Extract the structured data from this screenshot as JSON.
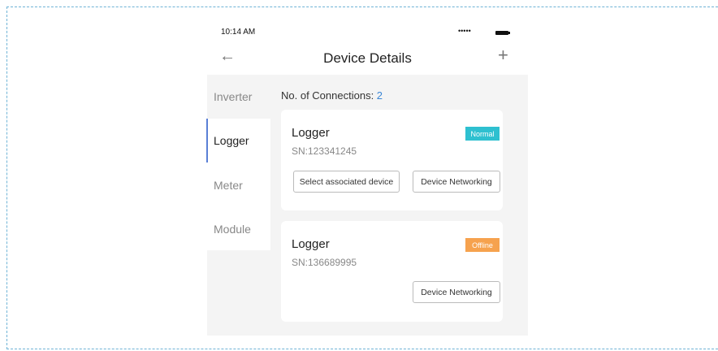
{
  "status_bar": {
    "time": "10:14 AM",
    "signal": "•••••"
  },
  "header": {
    "back_icon": "←",
    "title": "Device Details",
    "add_icon": "+"
  },
  "tabs": [
    {
      "label": "Inverter"
    },
    {
      "label": "Logger",
      "active": true
    },
    {
      "label": "Meter"
    },
    {
      "label": "Module"
    }
  ],
  "connections": {
    "label": "No. of Connections: ",
    "count": "2"
  },
  "devices": [
    {
      "name": "Logger",
      "sn": "SN:123341245",
      "status": "Normal",
      "buttons": {
        "select": "Select associated device",
        "networking": "Device Networking"
      }
    },
    {
      "name": "Logger",
      "sn": "SN:136689995",
      "status": "Offline",
      "buttons": {
        "networking": "Device Networking"
      }
    }
  ],
  "colors": {
    "normal": "#2ec0d0",
    "offline": "#f6a24e",
    "accent": "#3a86d6",
    "active_tab": "#5a7fd6"
  }
}
